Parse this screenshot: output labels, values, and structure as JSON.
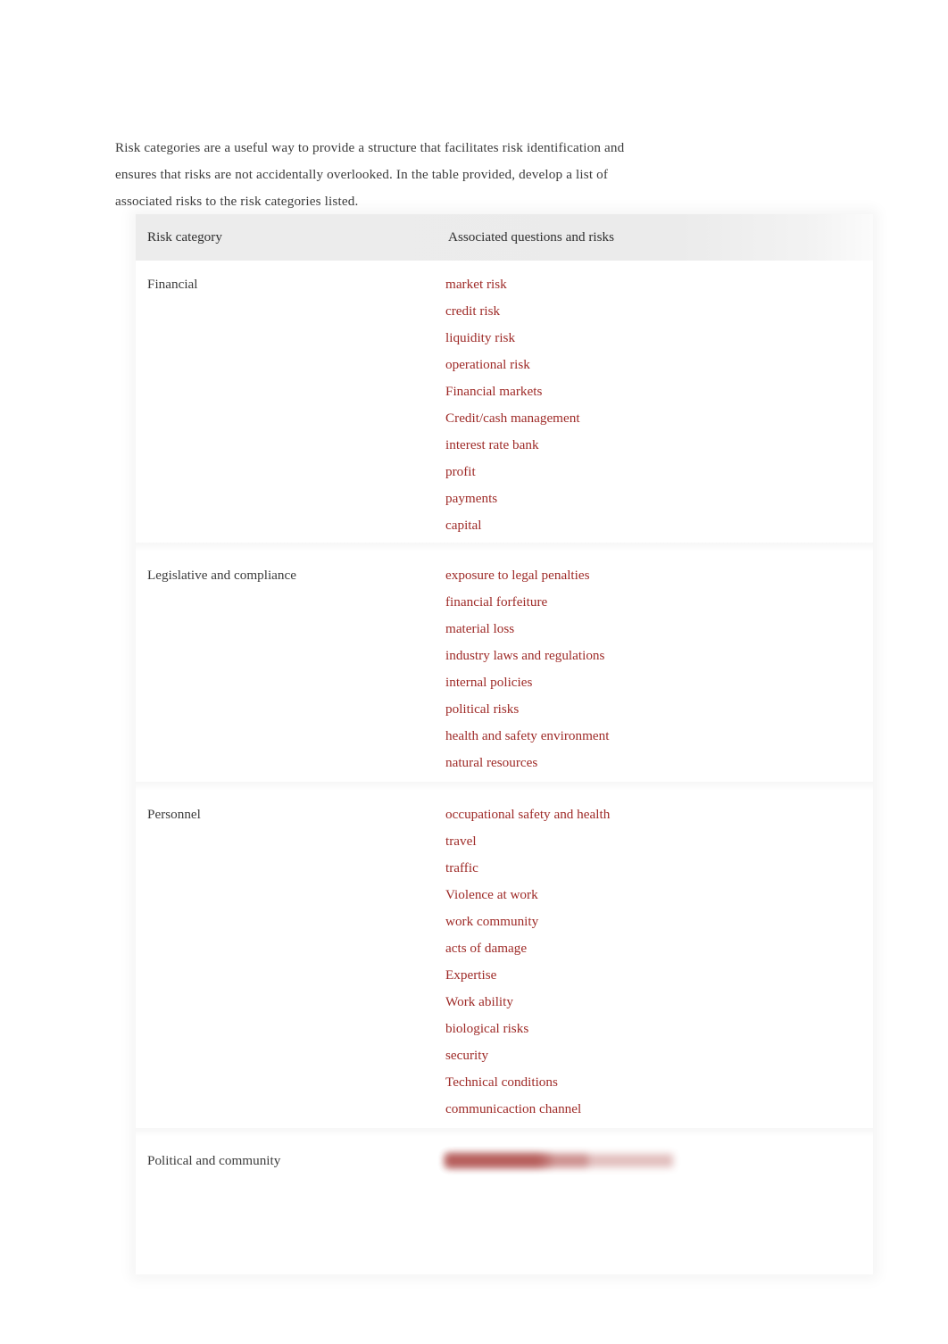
{
  "document": {
    "intro_paragraph": "Risk categories are a useful way to provide a structure that facilitates risk identification and ensures that risks are not accidentally overlooked. In the table provided, develop a list of associated risks to the risk categories listed."
  },
  "colors": {
    "risk_text": "#9e2a27",
    "body_text": "#3b3b3b",
    "header_band": "#ececec",
    "page_background": "#ffffff"
  },
  "table": {
    "columns": [
      {
        "header": "Risk category"
      },
      {
        "header": "Associated questions and risks"
      }
    ],
    "rows": [
      {
        "category": "Financial",
        "risks": [
          "market risk",
          "credit risk",
          "liquidity risk",
          "operational risk",
          "Financial markets",
          "Credit/cash management",
          "interest rate bank",
          "profit",
          "payments",
          "capital"
        ],
        "redacted": false
      },
      {
        "category": "Legislative and compliance",
        "risks": [
          "exposure to legal penalties",
          "financial forfeiture",
          "material loss",
          "industry laws and regulations",
          "internal policies",
          "political risks",
          "health and safety environment",
          "natural resources"
        ],
        "redacted": false
      },
      {
        "category": "Personnel",
        "risks": [
          "occupational safety and health",
          "travel",
          "traffic",
          "Violence at work",
          "work community",
          "acts of damage",
          "Expertise",
          "Work ability",
          "biological risks",
          "security",
          "Technical conditions",
          "communicaction channel"
        ],
        "redacted": false
      },
      {
        "category": "Political and community",
        "risks": [
          "",
          "",
          "",
          ""
        ],
        "redacted": true,
        "redacted_widths": [
          255,
          160,
          118,
          108
        ]
      }
    ]
  }
}
